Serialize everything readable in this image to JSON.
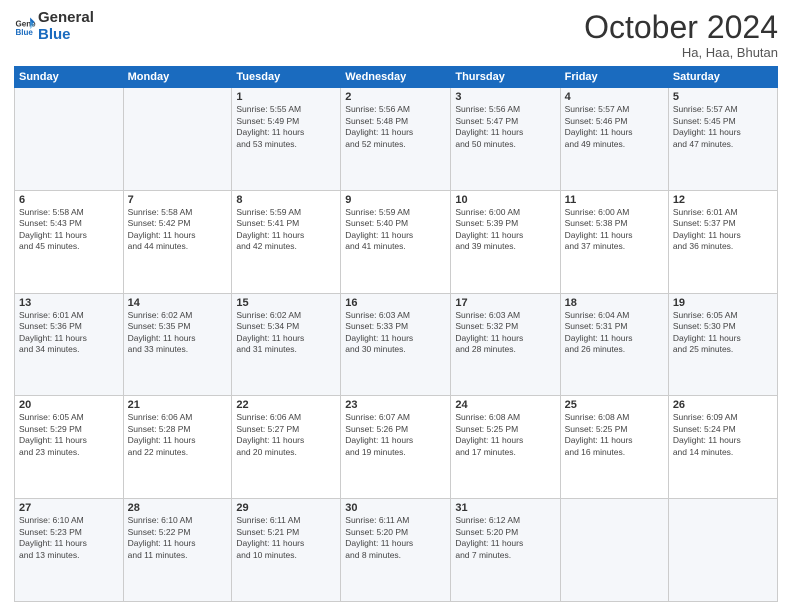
{
  "header": {
    "logo_general": "General",
    "logo_blue": "Blue",
    "calendar_title": "October 2024",
    "calendar_subtitle": "Ha, Haa, Bhutan"
  },
  "days_of_week": [
    "Sunday",
    "Monday",
    "Tuesday",
    "Wednesday",
    "Thursday",
    "Friday",
    "Saturday"
  ],
  "weeks": [
    [
      {
        "day": "",
        "info": ""
      },
      {
        "day": "",
        "info": ""
      },
      {
        "day": "1",
        "info": "Sunrise: 5:55 AM\nSunset: 5:49 PM\nDaylight: 11 hours\nand 53 minutes."
      },
      {
        "day": "2",
        "info": "Sunrise: 5:56 AM\nSunset: 5:48 PM\nDaylight: 11 hours\nand 52 minutes."
      },
      {
        "day": "3",
        "info": "Sunrise: 5:56 AM\nSunset: 5:47 PM\nDaylight: 11 hours\nand 50 minutes."
      },
      {
        "day": "4",
        "info": "Sunrise: 5:57 AM\nSunset: 5:46 PM\nDaylight: 11 hours\nand 49 minutes."
      },
      {
        "day": "5",
        "info": "Sunrise: 5:57 AM\nSunset: 5:45 PM\nDaylight: 11 hours\nand 47 minutes."
      }
    ],
    [
      {
        "day": "6",
        "info": "Sunrise: 5:58 AM\nSunset: 5:43 PM\nDaylight: 11 hours\nand 45 minutes."
      },
      {
        "day": "7",
        "info": "Sunrise: 5:58 AM\nSunset: 5:42 PM\nDaylight: 11 hours\nand 44 minutes."
      },
      {
        "day": "8",
        "info": "Sunrise: 5:59 AM\nSunset: 5:41 PM\nDaylight: 11 hours\nand 42 minutes."
      },
      {
        "day": "9",
        "info": "Sunrise: 5:59 AM\nSunset: 5:40 PM\nDaylight: 11 hours\nand 41 minutes."
      },
      {
        "day": "10",
        "info": "Sunrise: 6:00 AM\nSunset: 5:39 PM\nDaylight: 11 hours\nand 39 minutes."
      },
      {
        "day": "11",
        "info": "Sunrise: 6:00 AM\nSunset: 5:38 PM\nDaylight: 11 hours\nand 37 minutes."
      },
      {
        "day": "12",
        "info": "Sunrise: 6:01 AM\nSunset: 5:37 PM\nDaylight: 11 hours\nand 36 minutes."
      }
    ],
    [
      {
        "day": "13",
        "info": "Sunrise: 6:01 AM\nSunset: 5:36 PM\nDaylight: 11 hours\nand 34 minutes."
      },
      {
        "day": "14",
        "info": "Sunrise: 6:02 AM\nSunset: 5:35 PM\nDaylight: 11 hours\nand 33 minutes."
      },
      {
        "day": "15",
        "info": "Sunrise: 6:02 AM\nSunset: 5:34 PM\nDaylight: 11 hours\nand 31 minutes."
      },
      {
        "day": "16",
        "info": "Sunrise: 6:03 AM\nSunset: 5:33 PM\nDaylight: 11 hours\nand 30 minutes."
      },
      {
        "day": "17",
        "info": "Sunrise: 6:03 AM\nSunset: 5:32 PM\nDaylight: 11 hours\nand 28 minutes."
      },
      {
        "day": "18",
        "info": "Sunrise: 6:04 AM\nSunset: 5:31 PM\nDaylight: 11 hours\nand 26 minutes."
      },
      {
        "day": "19",
        "info": "Sunrise: 6:05 AM\nSunset: 5:30 PM\nDaylight: 11 hours\nand 25 minutes."
      }
    ],
    [
      {
        "day": "20",
        "info": "Sunrise: 6:05 AM\nSunset: 5:29 PM\nDaylight: 11 hours\nand 23 minutes."
      },
      {
        "day": "21",
        "info": "Sunrise: 6:06 AM\nSunset: 5:28 PM\nDaylight: 11 hours\nand 22 minutes."
      },
      {
        "day": "22",
        "info": "Sunrise: 6:06 AM\nSunset: 5:27 PM\nDaylight: 11 hours\nand 20 minutes."
      },
      {
        "day": "23",
        "info": "Sunrise: 6:07 AM\nSunset: 5:26 PM\nDaylight: 11 hours\nand 19 minutes."
      },
      {
        "day": "24",
        "info": "Sunrise: 6:08 AM\nSunset: 5:25 PM\nDaylight: 11 hours\nand 17 minutes."
      },
      {
        "day": "25",
        "info": "Sunrise: 6:08 AM\nSunset: 5:25 PM\nDaylight: 11 hours\nand 16 minutes."
      },
      {
        "day": "26",
        "info": "Sunrise: 6:09 AM\nSunset: 5:24 PM\nDaylight: 11 hours\nand 14 minutes."
      }
    ],
    [
      {
        "day": "27",
        "info": "Sunrise: 6:10 AM\nSunset: 5:23 PM\nDaylight: 11 hours\nand 13 minutes."
      },
      {
        "day": "28",
        "info": "Sunrise: 6:10 AM\nSunset: 5:22 PM\nDaylight: 11 hours\nand 11 minutes."
      },
      {
        "day": "29",
        "info": "Sunrise: 6:11 AM\nSunset: 5:21 PM\nDaylight: 11 hours\nand 10 minutes."
      },
      {
        "day": "30",
        "info": "Sunrise: 6:11 AM\nSunset: 5:20 PM\nDaylight: 11 hours\nand 8 minutes."
      },
      {
        "day": "31",
        "info": "Sunrise: 6:12 AM\nSunset: 5:20 PM\nDaylight: 11 hours\nand 7 minutes."
      },
      {
        "day": "",
        "info": ""
      },
      {
        "day": "",
        "info": ""
      }
    ]
  ]
}
